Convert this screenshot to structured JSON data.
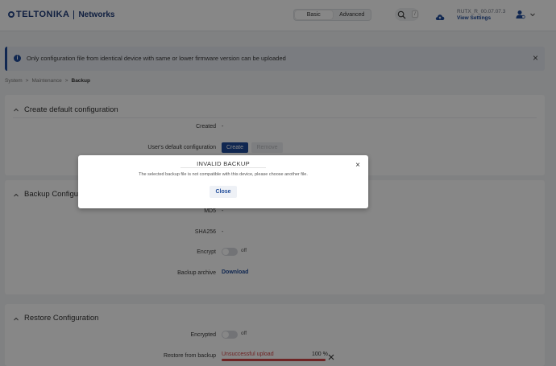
{
  "header": {
    "brand": "TELTONIKA",
    "brand_sub": "Networks",
    "mode_basic": "Basic",
    "mode_advanced": "Advanced",
    "search_shortcut": "/",
    "device_name": "RUTX_R_00.07.07.3",
    "view_settings": "View Settings"
  },
  "alert": {
    "icon": "i",
    "text": "Only configuration file from identical device with same or lower firmware version can be uploaded",
    "close": "×"
  },
  "breadcrumb": {
    "items": [
      "System",
      "Maintenance",
      "Backup"
    ],
    "sep": ">"
  },
  "default_config": {
    "title": "Create default configuration",
    "created_label": "Created",
    "created_value": "-",
    "users_default_label": "User's default configuration",
    "create_btn": "Create",
    "remove_btn": "Remove"
  },
  "backup_config": {
    "title": "Backup Configuration",
    "md5_label": "MD5",
    "md5_value": "-",
    "sha256_label": "SHA256",
    "sha256_value": "-",
    "encrypt_label": "Encrypt",
    "encrypt_state": "off",
    "archive_label": "Backup archive",
    "download": "Download"
  },
  "restore_config": {
    "title": "Restore Configuration",
    "encrypted_label": "Encrypted",
    "encrypted_state": "off",
    "restore_label": "Restore from backup",
    "upload_status": "Unsuccessful upload",
    "upload_pct": "100 %",
    "upload_progress": 1.0
  },
  "modal": {
    "title": "INVALID BACKUP",
    "message": "The selected backup file is not compatible with this device, please choose another file.",
    "close_btn": "Close",
    "close_icon": "×"
  },
  "icons": [
    "search-icon",
    "cloud-upload-icon",
    "user-icon",
    "chevron-down-icon",
    "chevron-up-icon",
    "info-icon",
    "close-icon"
  ],
  "colors": {
    "primary": "#1f4b99",
    "error": "#d04545",
    "background": "#f2f3f5"
  }
}
